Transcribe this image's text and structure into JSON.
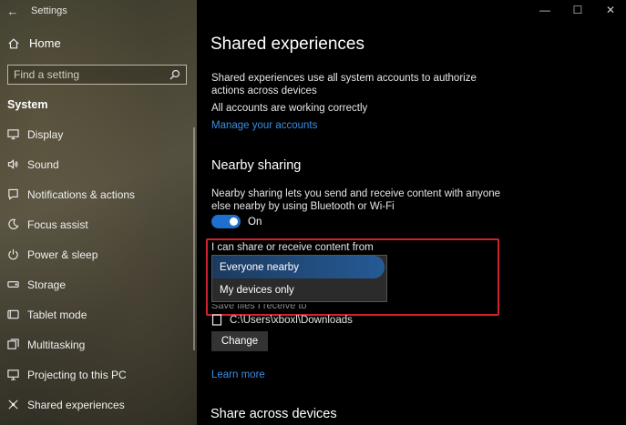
{
  "window": {
    "app_title": "Settings",
    "controls": [
      "—",
      "☐",
      "✕"
    ]
  },
  "sidebar": {
    "home_label": "Home",
    "search_placeholder": "Find a setting",
    "section_title": "System",
    "items": [
      {
        "label": "Display",
        "icon": "display-icon"
      },
      {
        "label": "Sound",
        "icon": "sound-icon"
      },
      {
        "label": "Notifications & actions",
        "icon": "notifications-icon"
      },
      {
        "label": "Focus assist",
        "icon": "moon-icon"
      },
      {
        "label": "Power & sleep",
        "icon": "power-icon"
      },
      {
        "label": "Storage",
        "icon": "storage-icon"
      },
      {
        "label": "Tablet mode",
        "icon": "tablet-icon"
      },
      {
        "label": "Multitasking",
        "icon": "multitasking-icon"
      },
      {
        "label": "Projecting to this PC",
        "icon": "projecting-icon"
      },
      {
        "label": "Shared experiences",
        "icon": "shared-experiences-icon"
      }
    ]
  },
  "main": {
    "title": "Shared experiences",
    "description": "Shared experiences use all system accounts to authorize actions across devices",
    "status": "All accounts are working correctly",
    "manage_link": "Manage your accounts",
    "nearby": {
      "title": "Nearby sharing",
      "description": "Nearby sharing lets you send and receive content with anyone else nearby by using Bluetooth or Wi-Fi",
      "toggle_state": "On",
      "share_label": "I can share or receive content from",
      "dropdown_options": [
        "Everyone nearby",
        "My devices only"
      ],
      "selected_option": "Everyone nearby",
      "save_label": "Save files I receive to",
      "save_path": "C:\\Users\\xboxl\\Downloads",
      "change_button": "Change",
      "learn_more": "Learn more"
    },
    "across_title": "Share across devices"
  },
  "colors": {
    "accent": "#1f6fcf",
    "link": "#3b8ee0",
    "highlight": "#d1222c"
  }
}
